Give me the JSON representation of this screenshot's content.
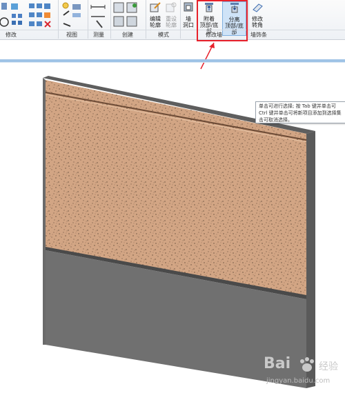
{
  "ribbon": {
    "panels": [
      "修改",
      "视图",
      "测量",
      "创建",
      "模式",
      "修改墙",
      "墙饰条"
    ],
    "buttons": {
      "edit_profile": "编辑\n轮廓",
      "reset_profile": "重设\n轮廓",
      "wall_opening": "墙\n洞口",
      "attach_top_base": "附着\n顶部/底部",
      "detach_top_base": "分离\n顶部/底部",
      "modify_sweep": "修改\n转角"
    }
  },
  "tooltip": {
    "lines": [
      "单击可进行选择; 按 Tab 键并单击可",
      "Ctrl 键并单击可将新项目添加到选择集",
      "击可取消选择。"
    ]
  },
  "watermark": {
    "brand": "Bai",
    "brand_cn": "经验",
    "url": "jingyan.baidu.com"
  },
  "colors": {
    "wall_plaster": "#d2a584",
    "wall_concrete": "#707070",
    "highlight": "#e8202a",
    "ribbon_active": "#cfe3f7"
  }
}
